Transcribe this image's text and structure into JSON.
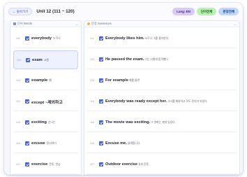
{
  "header": {
    "back_label": "← 돌아가기",
    "unit_title": "Unit 12 (111 ~ 120)",
    "lang_label": "Lang: EN",
    "words_btn": "단어전체",
    "sents_btn": "문장전체"
  },
  "words_panel": {
    "title": "단어 Words",
    "collapse": "—"
  },
  "sentences_panel": {
    "title": "문장 Sentences",
    "collapse": "—"
  },
  "words": [
    {
      "num": "111",
      "term": "everybody",
      "meaning": "누구나"
    },
    {
      "num": "112",
      "term": "exam",
      "meaning": "시험"
    },
    {
      "num": "113",
      "term": "example",
      "meaning": "예"
    },
    {
      "num": "114",
      "term": "except ~제외하고",
      "meaning": ""
    },
    {
      "num": "115",
      "term": "exciting",
      "meaning": "신나는"
    },
    {
      "num": "116",
      "term": "excuse",
      "meaning": "용서하다"
    },
    {
      "num": "117",
      "term": "exercise",
      "meaning": "운동, 연습"
    }
  ],
  "sentences": [
    {
      "num": "111",
      "en": "Everybody likes him.",
      "ko": "누구나 그를 좋아한다."
    },
    {
      "num": "112",
      "en": "He passed the exam.",
      "ko": "그는 시험에 합격했다."
    },
    {
      "num": "113",
      "en": "For example",
      "ko": "예를 들면"
    },
    {
      "num": "114",
      "en": "Everybody was ready except her.",
      "ko": "그녀를 제외하고 모두 준비가 되었다."
    },
    {
      "num": "115",
      "en": "The movie was exciting.",
      "ko": "그 영화는 재미 있었다."
    },
    {
      "num": "116",
      "en": "Excuse me,",
      "ko": "실례합니다."
    },
    {
      "num": "117",
      "en": "Outdoor exercise",
      "ko": "실외 운동"
    }
  ],
  "colors": {
    "accent": "#4a63d6",
    "lang": "#d9c9f7",
    "words": "#b7f2b0",
    "sents": "#bfd8ff"
  }
}
